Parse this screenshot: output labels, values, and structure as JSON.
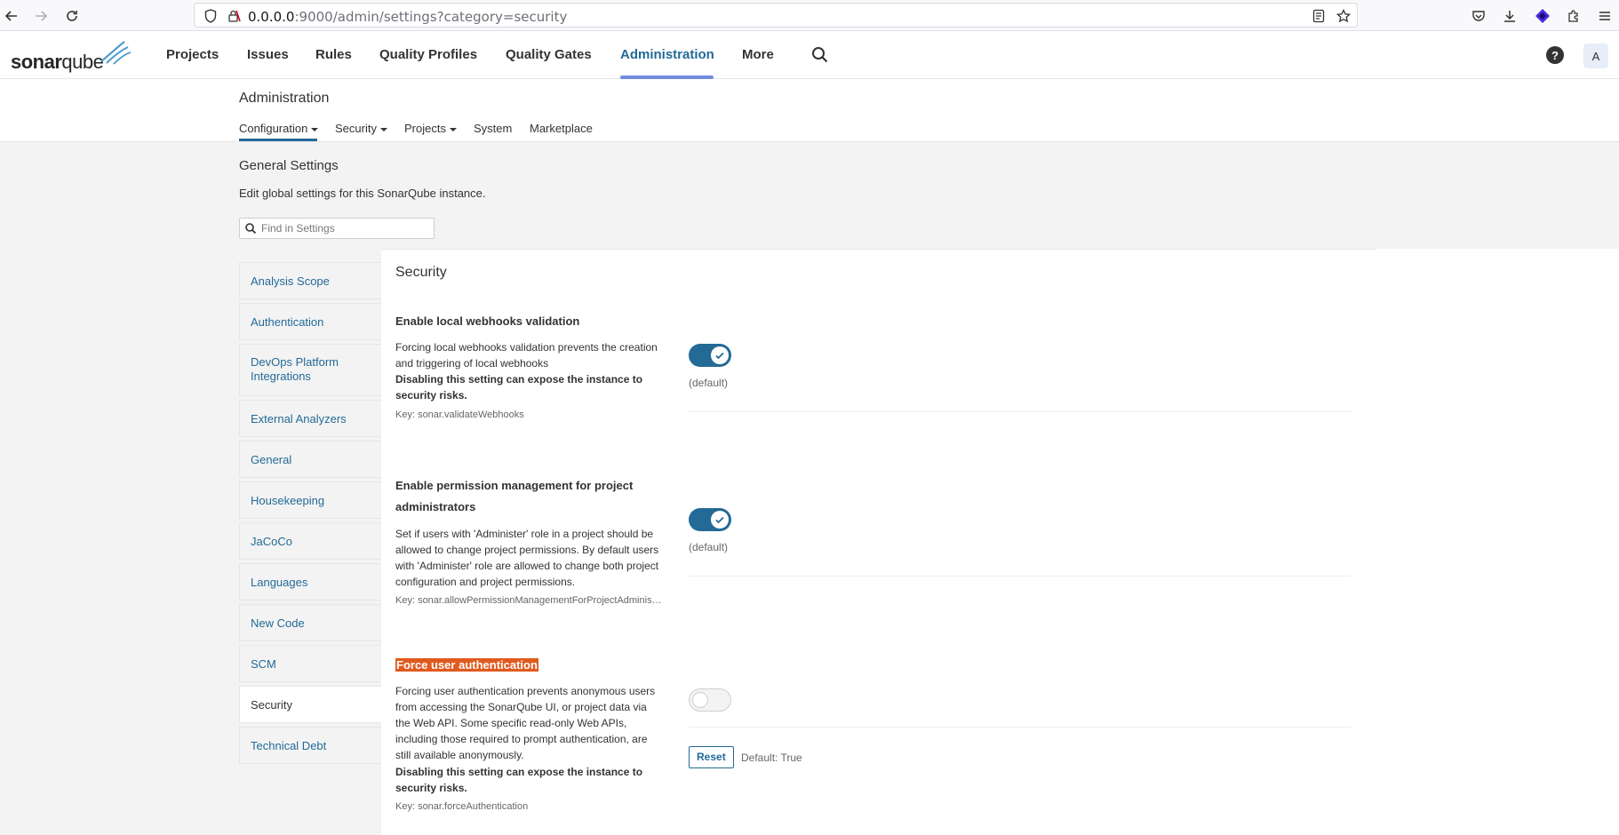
{
  "browser": {
    "url_host": "0.0.0.0",
    "url_rest": ":9000/admin/settings?category=security"
  },
  "app": {
    "logo_text_bold": "sonar",
    "logo_text_rest": "qube",
    "nav": [
      {
        "label": "Projects"
      },
      {
        "label": "Issues"
      },
      {
        "label": "Rules"
      },
      {
        "label": "Quality Profiles"
      },
      {
        "label": "Quality Gates"
      },
      {
        "label": "Administration"
      },
      {
        "label": "More"
      }
    ],
    "avatar_letter": "A",
    "help_glyph": "?"
  },
  "admin": {
    "title": "Administration",
    "subnav": [
      {
        "label": "Configuration"
      },
      {
        "label": "Security"
      },
      {
        "label": "Projects"
      },
      {
        "label": "System"
      },
      {
        "label": "Marketplace"
      }
    ]
  },
  "settings": {
    "title": "General Settings",
    "description": "Edit global settings for this SonarQube instance.",
    "search_placeholder": "Find in Settings",
    "categories": [
      {
        "label": "Analysis Scope"
      },
      {
        "label": "Authentication"
      },
      {
        "label": "DevOps Platform Integrations"
      },
      {
        "label": "External Analyzers"
      },
      {
        "label": "General"
      },
      {
        "label": "Housekeeping"
      },
      {
        "label": "JaCoCo"
      },
      {
        "label": "Languages"
      },
      {
        "label": "New Code"
      },
      {
        "label": "SCM"
      },
      {
        "label": "Security"
      },
      {
        "label": "Technical Debt"
      }
    ],
    "active_category": "Security",
    "section_title": "Security",
    "items": [
      {
        "title": "Enable local webhooks validation",
        "desc": "Forcing local webhooks validation prevents the creation and triggering of local webhooks",
        "warning": "Disabling this setting can expose the instance to security risks.",
        "key": "Key: sonar.validateWebhooks",
        "enabled": true,
        "default_label": "(default)"
      },
      {
        "title": "Enable permission management for project administrators",
        "desc": "Set if users with 'Administer' role in a project should be allowed to change project permissions. By default users with 'Administer' role are allowed to change both project configuration and project permissions.",
        "key": "Key: sonar.allowPermissionManagementForProjectAdministrators",
        "enabled": true,
        "default_label": "(default)"
      },
      {
        "title": "Force user authentication",
        "desc": "Forcing user authentication prevents anonymous users from accessing the SonarQube UI, or project data via the Web API. Some specific read-only Web APIs, including those required to prompt authentication, are still available anonymously.",
        "warning": "Disabling this setting can expose the instance to security risks.",
        "key": "Key: sonar.forceAuthentication",
        "enabled": false,
        "reset_label": "Reset",
        "default_value": "Default: True"
      }
    ]
  },
  "colors": {
    "accent": "#236a97",
    "highlight": "#e05a1f",
    "nav_underline": "#6f8bdb"
  }
}
